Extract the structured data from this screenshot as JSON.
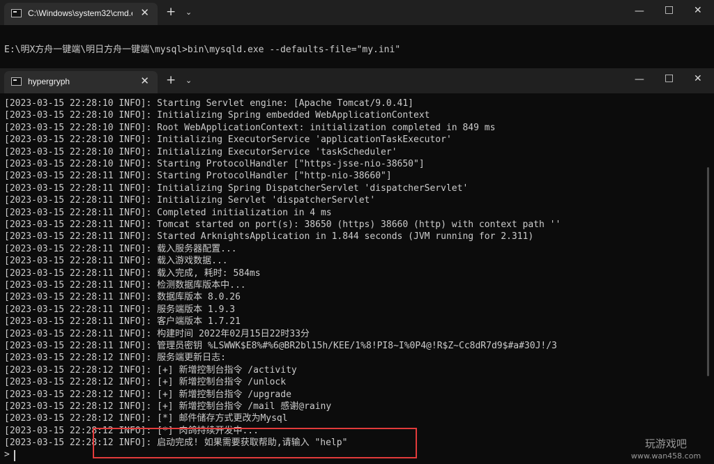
{
  "top_window": {
    "tab_title": "C:\\Windows\\system32\\cmd.e:",
    "close_glyph": "✕",
    "newtab_glyph": "+",
    "dropdown_glyph": "⌄",
    "minimize_glyph": "—",
    "maximize_glyph": "□",
    "close_window_glyph": "✕",
    "command": "E:\\明X方舟一键端\\明日方舟一键端\\mysql>bin\\mysqld.exe --defaults-file=\"my.ini\""
  },
  "console_window": {
    "tab_title": "hypergryph",
    "close_glyph": "✕",
    "newtab_glyph": "+",
    "dropdown_glyph": "⌄",
    "minimize_glyph": "—",
    "maximize_glyph": "□",
    "close_window_glyph": "✕",
    "lines": [
      "[2023-03-15 22:28:10 INFO]: Starting Servlet engine: [Apache Tomcat/9.0.41]",
      "[2023-03-15 22:28:10 INFO]: Initializing Spring embedded WebApplicationContext",
      "[2023-03-15 22:28:10 INFO]: Root WebApplicationContext: initialization completed in 849 ms",
      "[2023-03-15 22:28:10 INFO]: Initializing ExecutorService 'applicationTaskExecutor'",
      "[2023-03-15 22:28:10 INFO]: Initializing ExecutorService 'taskScheduler'",
      "[2023-03-15 22:28:10 INFO]: Starting ProtocolHandler [\"https-jsse-nio-38650\"]",
      "[2023-03-15 22:28:11 INFO]: Starting ProtocolHandler [\"http-nio-38660\"]",
      "[2023-03-15 22:28:11 INFO]: Initializing Spring DispatcherServlet 'dispatcherServlet'",
      "[2023-03-15 22:28:11 INFO]: Initializing Servlet 'dispatcherServlet'",
      "[2023-03-15 22:28:11 INFO]: Completed initialization in 4 ms",
      "[2023-03-15 22:28:11 INFO]: Tomcat started on port(s): 38650 (https) 38660 (http) with context path ''",
      "[2023-03-15 22:28:11 INFO]: Started ArknightsApplication in 1.844 seconds (JVM running for 2.311)",
      "[2023-03-15 22:28:11 INFO]: 载入服务器配置...",
      "[2023-03-15 22:28:11 INFO]: 载入游戏数据...",
      "[2023-03-15 22:28:11 INFO]: 载入完成, 耗时: 584ms",
      "[2023-03-15 22:28:11 INFO]: 检测数据库版本中...",
      "[2023-03-15 22:28:11 INFO]: 数据库版本 8.0.26",
      "[2023-03-15 22:28:11 INFO]: 服务端版本 1.9.3",
      "[2023-03-15 22:28:11 INFO]: 客户端版本 1.7.21",
      "[2023-03-15 22:28:11 INFO]: 构建时间 2022年02月15日22时33分",
      "[2023-03-15 22:28:11 INFO]: 管理员密钥 %LSWWK$E8%#%6@BR2bl15h/KEE/1%8!PI8~I%0P4@!R$Z~Cc8dR7d9$#a#30J!/3",
      "[2023-03-15 22:28:12 INFO]: 服务端更新日志:",
      "[2023-03-15 22:28:12 INFO]: [+] 新增控制台指令 /activity",
      "[2023-03-15 22:28:12 INFO]: [+] 新增控制台指令 /unlock",
      "[2023-03-15 22:28:12 INFO]: [+] 新增控制台指令 /upgrade",
      "[2023-03-15 22:28:12 INFO]: [+] 新增控制台指令 /mail 感谢@rainy",
      "[2023-03-15 22:28:12 INFO]: [*] 邮件储存方式更改为Mysql",
      "[2023-03-15 22:28:12 INFO]: [*] 肉鸽持续开发中...",
      "[2023-03-15 22:28:12 INFO]: 启动完成! 如果需要获取帮助,请输入 \"help\""
    ],
    "prompt": ">"
  },
  "watermark": {
    "text": "玩游戏吧",
    "url": "www.wan458.com"
  },
  "colors": {
    "background": "#0c0c0c",
    "tabbar": "#202020",
    "text": "#cccccc",
    "highlight_box": "#e23b3b"
  }
}
